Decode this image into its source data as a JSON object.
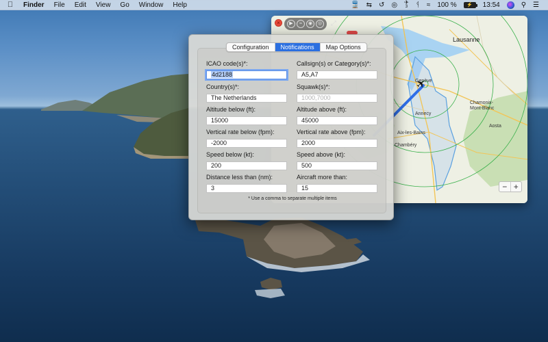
{
  "menubar": {
    "apple_icon": "apple-logo-icon",
    "app_name": "Finder",
    "menus": [
      "File",
      "Edit",
      "View",
      "Go",
      "Window",
      "Help"
    ],
    "status": {
      "flight_badge": "3",
      "battery_percent": "100 %",
      "time": "13:54"
    }
  },
  "map": {
    "labels": {
      "lausanne": "Lausanne",
      "geneve": "Genève",
      "annecy": "Annecy",
      "chamonix": "Chamonix-\nMont-Blanc",
      "aix": "Aix-les-Bains",
      "chambery": "Chambéry",
      "aosta": "Aosta"
    },
    "zoom_out": "−",
    "zoom_in": "+",
    "colors": {
      "track": "#2f6ee8",
      "range_rings": "#38b04a",
      "border": "#5aa0e0"
    }
  },
  "prefs": {
    "tabs": [
      {
        "label": "Configuration",
        "active": false
      },
      {
        "label": "Notifications",
        "active": true
      },
      {
        "label": "Map Options",
        "active": false
      }
    ],
    "fields": {
      "icao": {
        "label": "ICAO code(s)*:",
        "value": "4d2188"
      },
      "callsign": {
        "label": "Callsign(s) or Category(s)*:",
        "value": "A5,A7"
      },
      "country": {
        "label": "Country(s)*:",
        "value": "The Netherlands"
      },
      "squawk": {
        "label": "Squawk(s)*:",
        "placeholder": "1000,7000"
      },
      "alt_below": {
        "label": "Altitude below (ft):",
        "value": "15000"
      },
      "alt_above": {
        "label": "Altitude above (ft):",
        "value": "45000"
      },
      "vrate_below": {
        "label": "Vertical rate below (fpm):",
        "value": "-2000"
      },
      "vrate_above": {
        "label": "Vertical rate above (fpm):",
        "value": "2000"
      },
      "speed_below": {
        "label": "Speed below (kt):",
        "value": "200"
      },
      "speed_above": {
        "label": "Speed above (kt):",
        "value": "500"
      },
      "distance": {
        "label": "Distance less than (nm):",
        "value": "3"
      },
      "aircraft": {
        "label": "Aircraft more than:",
        "value": "15"
      }
    },
    "hint": "* Use a comma to separate multiple items"
  }
}
